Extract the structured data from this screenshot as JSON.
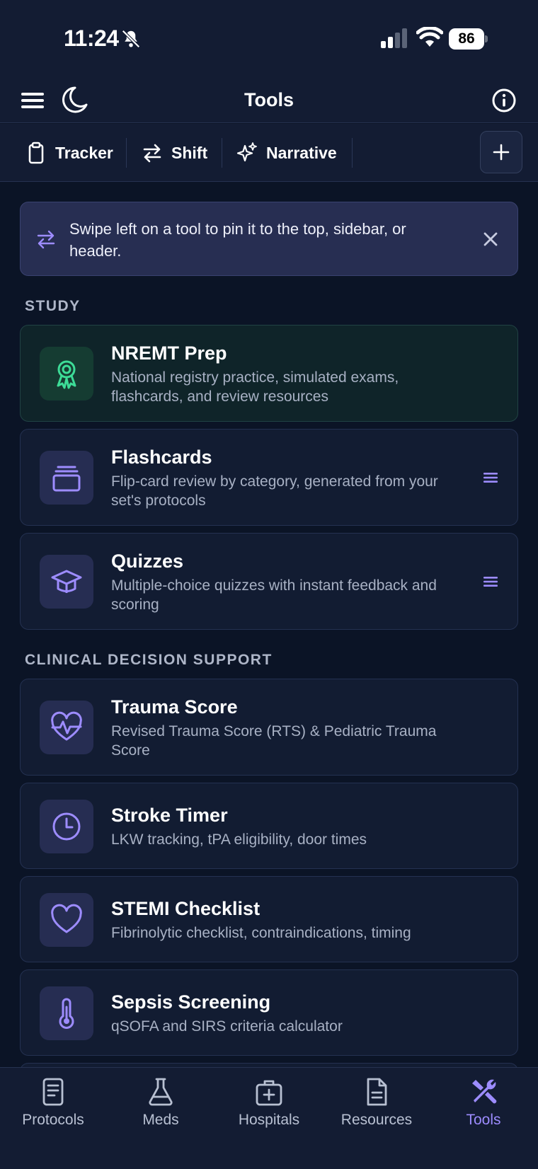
{
  "status_bar": {
    "time": "11:24",
    "battery": "86"
  },
  "header": {
    "title": "Tools"
  },
  "quickbar": {
    "items": [
      {
        "label": "Tracker",
        "icon": "clipboard-icon"
      },
      {
        "label": "Shift",
        "icon": "swap-arrows-icon"
      },
      {
        "label": "Narrative",
        "icon": "sparkles-icon"
      }
    ],
    "add_icon": "plus-icon"
  },
  "tip": {
    "text": "Swipe left on a tool to pin it to the top, sidebar, or header."
  },
  "sections": [
    {
      "label": "STUDY",
      "cards": [
        {
          "title": "NREMT Prep",
          "desc": "National registry practice, simulated exams, flashcards, and review resources",
          "icon": "award-ribbon-icon",
          "featured": true
        },
        {
          "title": "Flashcards",
          "desc": "Flip-card review by category, generated from your set's protocols",
          "icon": "card-stack-icon"
        },
        {
          "title": "Quizzes",
          "desc": "Multiple-choice quizzes with instant feedback and scoring",
          "icon": "graduation-cap-icon"
        }
      ]
    },
    {
      "label": "CLINICAL DECISION SUPPORT",
      "cards": [
        {
          "title": "Trauma Score",
          "desc": "Revised Trauma Score (RTS) & Pediatric Trauma Score",
          "icon": "heart-pulse-icon"
        },
        {
          "title": "Stroke Timer",
          "desc": "LKW tracking, tPA eligibility, door times",
          "icon": "clock-icon"
        },
        {
          "title": "STEMI Checklist",
          "desc": "Fibrinolytic checklist, contraindications, timing",
          "icon": "heart-icon"
        },
        {
          "title": "Sepsis Screening",
          "desc": "qSOFA and SIRS criteria calculator",
          "icon": "thermometer-icon"
        }
      ]
    }
  ],
  "bottom_nav": [
    {
      "label": "Protocols",
      "icon": "document-icon"
    },
    {
      "label": "Meds",
      "icon": "flask-icon"
    },
    {
      "label": "Hospitals",
      "icon": "medical-kit-icon"
    },
    {
      "label": "Resources",
      "icon": "file-text-icon"
    },
    {
      "label": "Tools",
      "icon": "tools-icon",
      "active": true
    }
  ],
  "colors": {
    "accent": "#9d8cff",
    "featured_icon": "#3ddc97",
    "background": "#0b1426",
    "card": "#121c32"
  }
}
